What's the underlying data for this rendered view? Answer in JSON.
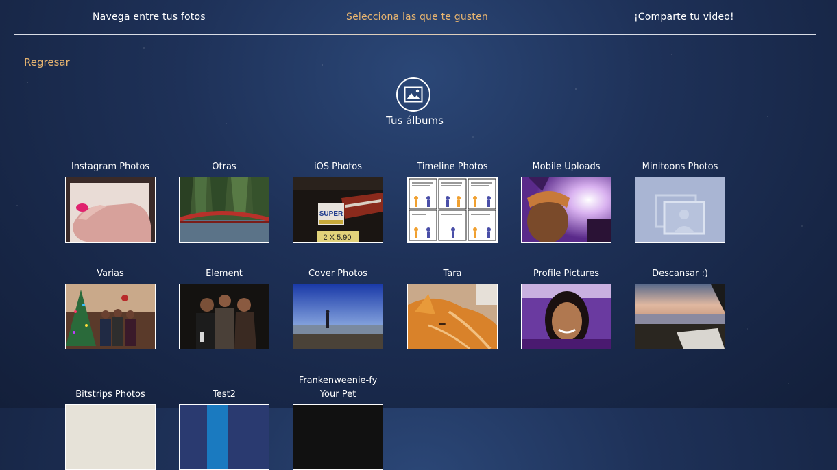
{
  "steps": [
    {
      "label": "Navega entre tus fotos"
    },
    {
      "label": "Selecciona las que te gusten"
    },
    {
      "label": "¡Comparte tu video!"
    }
  ],
  "back_label": "Regresar",
  "albums_icon": "image-icon",
  "albums_title": "Tus álbums",
  "albums": [
    {
      "name": "Instagram Photos",
      "thumb": "hand-photo"
    },
    {
      "name": "Otras",
      "thumb": "red-bridge-photo"
    },
    {
      "name": "iOS Photos",
      "thumb": "super-sign-photo"
    },
    {
      "name": "Timeline Photos",
      "thumb": "comic-strip"
    },
    {
      "name": "Mobile Uploads",
      "thumb": "concert-selfie-photo"
    },
    {
      "name": "Minitoons Photos",
      "thumb": "placeholder-album"
    },
    {
      "name": "Varias",
      "thumb": "christmas-group-photo"
    },
    {
      "name": "Element",
      "thumb": "friends-group-photo"
    },
    {
      "name": "Cover Photos",
      "thumb": "lake-sky-photo"
    },
    {
      "name": "Tara",
      "thumb": "orange-cat-photo"
    },
    {
      "name": "Profile Pictures",
      "thumb": "portrait-photo"
    },
    {
      "name": "Descansar :)",
      "thumb": "beach-sunset-photo"
    },
    {
      "name": "Bitstrips Photos",
      "thumb": "bitstrips-photo"
    },
    {
      "name": "Test2",
      "thumb": "test-photo"
    },
    {
      "name": "Frankenweenie-fy Your Pet",
      "thumb": "frankenweenie-photo"
    }
  ],
  "colors": {
    "accent": "#e8b570",
    "background": "#1e3158"
  }
}
